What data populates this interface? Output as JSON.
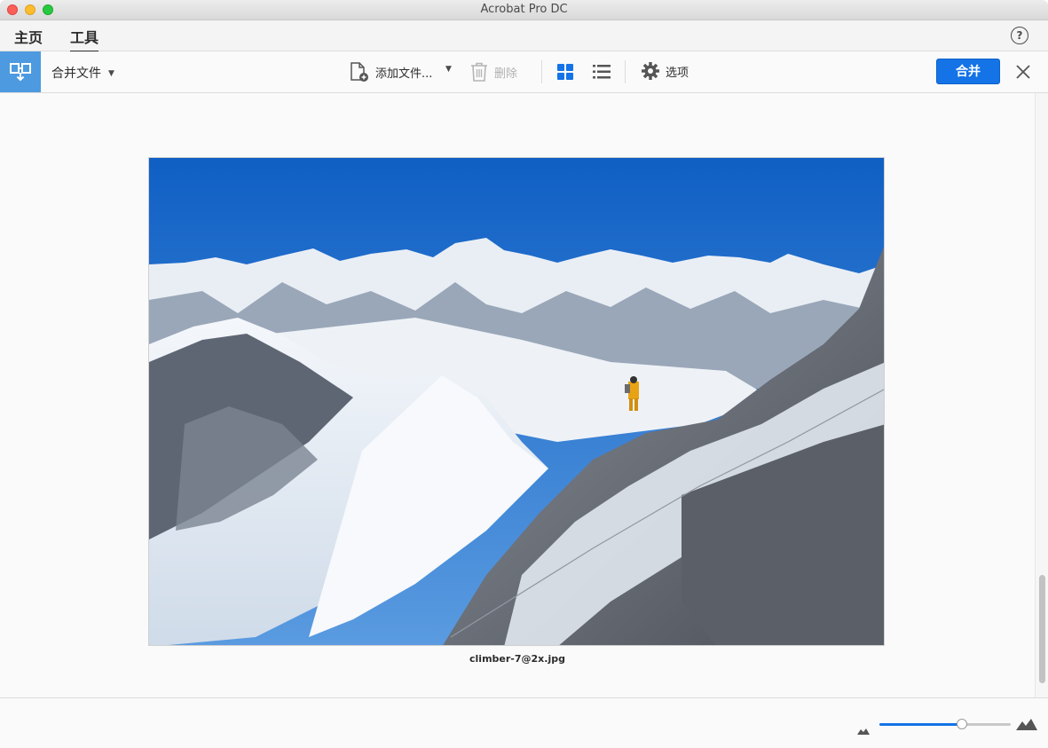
{
  "window": {
    "title": "Acrobat Pro DC"
  },
  "tabs": [
    {
      "label": "主页",
      "active": false
    },
    {
      "label": "工具",
      "active": true
    }
  ],
  "help": {
    "symbol": "?"
  },
  "toolbar": {
    "tool_name": "合并文件",
    "add_files_label": "添加文件...",
    "delete_label": "删除",
    "options_label": "选项",
    "merge_label": "合并"
  },
  "document": {
    "filename": "climber-7@2x.jpg"
  },
  "zoom": {
    "level_fraction": 0.63
  },
  "colors": {
    "accent": "#1473e6",
    "tool_tile": "#4d9ae0"
  }
}
